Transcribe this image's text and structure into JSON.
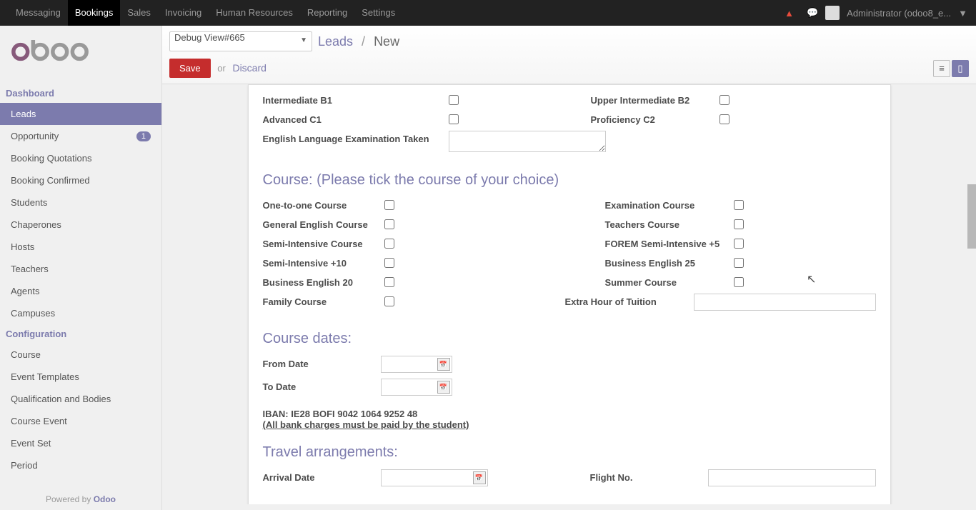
{
  "topnav": {
    "items": [
      "Messaging",
      "Bookings",
      "Sales",
      "Invoicing",
      "Human Resources",
      "Reporting",
      "Settings"
    ],
    "active": "Bookings",
    "user": "Administrator (odoo8_e...",
    "dropdown_arrow": "▼"
  },
  "header": {
    "debug_view": "Debug View#665",
    "breadcrumb_root": "Leads",
    "breadcrumb_sep": "/",
    "breadcrumb_current": "New",
    "save": "Save",
    "or": "or",
    "discard": "Discard"
  },
  "sidebar": {
    "dashboard_label": "Dashboard",
    "dashboard_items": [
      {
        "label": "Leads",
        "active": true
      },
      {
        "label": "Opportunity",
        "badge": "1"
      },
      {
        "label": "Booking Quotations"
      },
      {
        "label": "Booking Confirmed"
      },
      {
        "label": "Students"
      },
      {
        "label": "Chaperones"
      },
      {
        "label": "Hosts"
      },
      {
        "label": "Teachers"
      },
      {
        "label": "Agents"
      },
      {
        "label": "Campuses"
      }
    ],
    "config_label": "Configuration",
    "config_items": [
      {
        "label": "Course"
      },
      {
        "label": "Event Templates"
      },
      {
        "label": "Qualification and Bodies"
      },
      {
        "label": "Course Event"
      },
      {
        "label": "Event Set"
      },
      {
        "label": "Period"
      }
    ],
    "powered_prefix": "Powered by ",
    "powered_brand": "Odoo"
  },
  "form": {
    "level_fields": {
      "intermediate_b1": "Intermediate B1",
      "upper_intermediate_b2": "Upper Intermediate B2",
      "advanced_c1": "Advanced C1",
      "proficiency_c2": "Proficiency C2",
      "exam_taken": "English Language Examination Taken"
    },
    "course_section": "Course: (Please tick the course of your choice)",
    "course_fields": {
      "one_to_one": "One-to-one Course",
      "examination": "Examination Course",
      "general": "General English Course",
      "teachers": "Teachers Course",
      "semi_intensive": "Semi-Intensive Course",
      "forem_semi": "FOREM Semi-Intensive +5",
      "semi_intensive_10": "Semi-Intensive +10",
      "business_25": "Business English 25",
      "business_20": "Business English 20",
      "summer": "Summer Course",
      "family": "Family Course",
      "extra_hour": "Extra Hour of Tuition"
    },
    "dates_section": "Course dates:",
    "from_date": "From Date",
    "to_date": "To Date",
    "iban": "IBAN: IE28 BOFI 9042 1064 9252 48",
    "bank_note": "(All bank charges must be paid by the student)",
    "travel_section": "Travel arrangements:",
    "arrival_date": "Arrival Date",
    "flight_no": "Flight No."
  }
}
